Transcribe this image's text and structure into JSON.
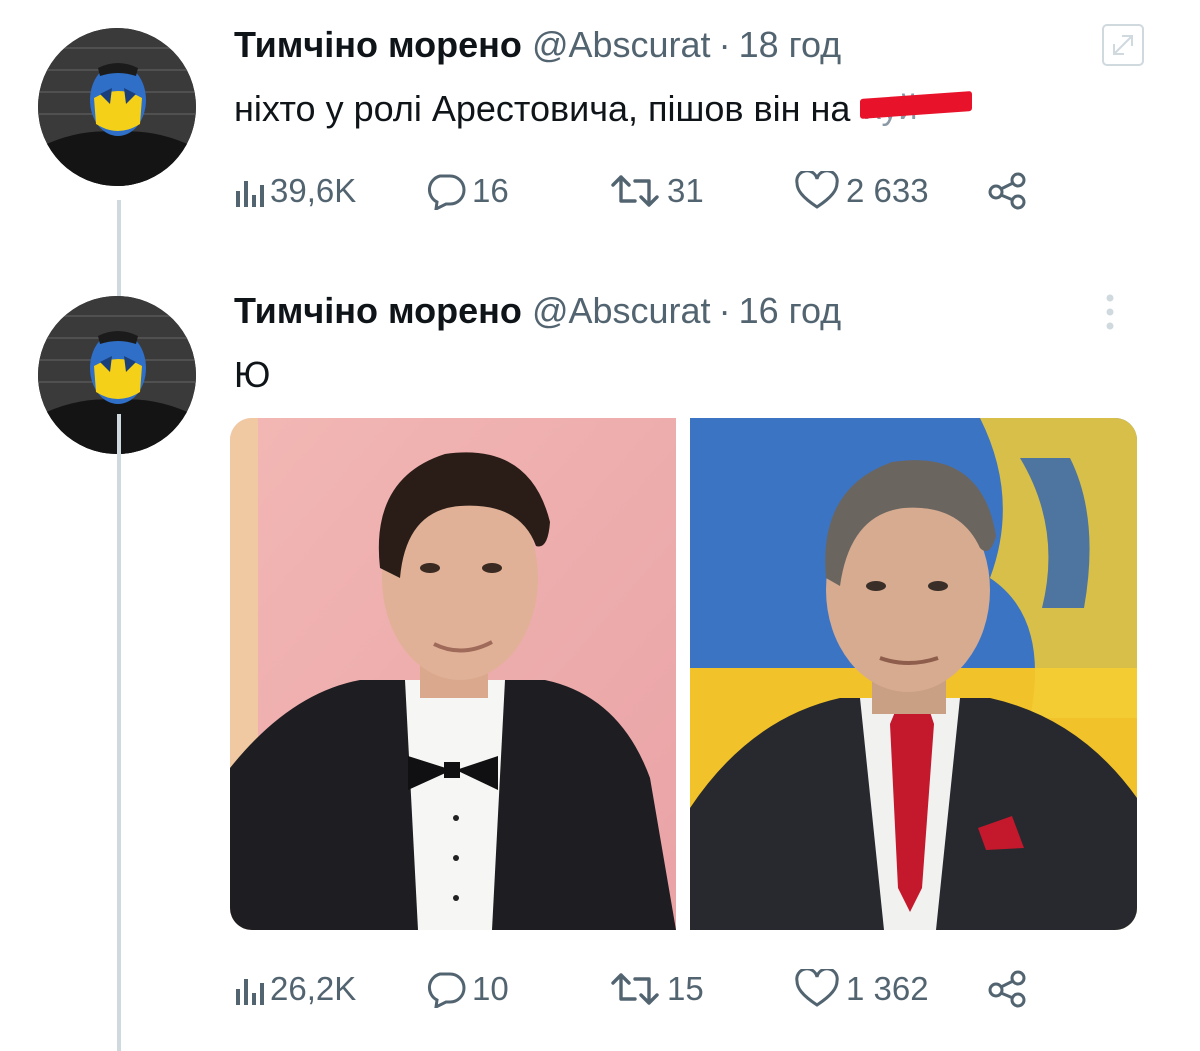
{
  "tweets": [
    {
      "author": {
        "name": "Тимчіно морено",
        "handle": "@Abscurat"
      },
      "separator": "·",
      "time": "18 год",
      "text": "ніхто у ролі Арестовича, пішов він на",
      "redacted_text": "хуй",
      "stats": {
        "views": "39,6K",
        "replies": "16",
        "retweets": "31",
        "likes": "2 633"
      }
    },
    {
      "author": {
        "name": "Тимчіно морено",
        "handle": "@Abscurat"
      },
      "separator": "·",
      "time": "16 год",
      "text": "Ю",
      "stats": {
        "views": "26,2K",
        "replies": "10",
        "retweets": "15",
        "likes": "1 362"
      }
    }
  ],
  "icons": {
    "views": "bar-chart-icon",
    "replies": "speech-bubble-icon",
    "retweets": "retweet-icon",
    "likes": "heart-icon",
    "share": "share-icon",
    "more": "more-vertical-icon",
    "expand": "expand-icon"
  },
  "colors": {
    "text": "#0f1419",
    "secondary": "#536471",
    "redaction": "#e8132b",
    "thread_line": "#cfd9de"
  }
}
